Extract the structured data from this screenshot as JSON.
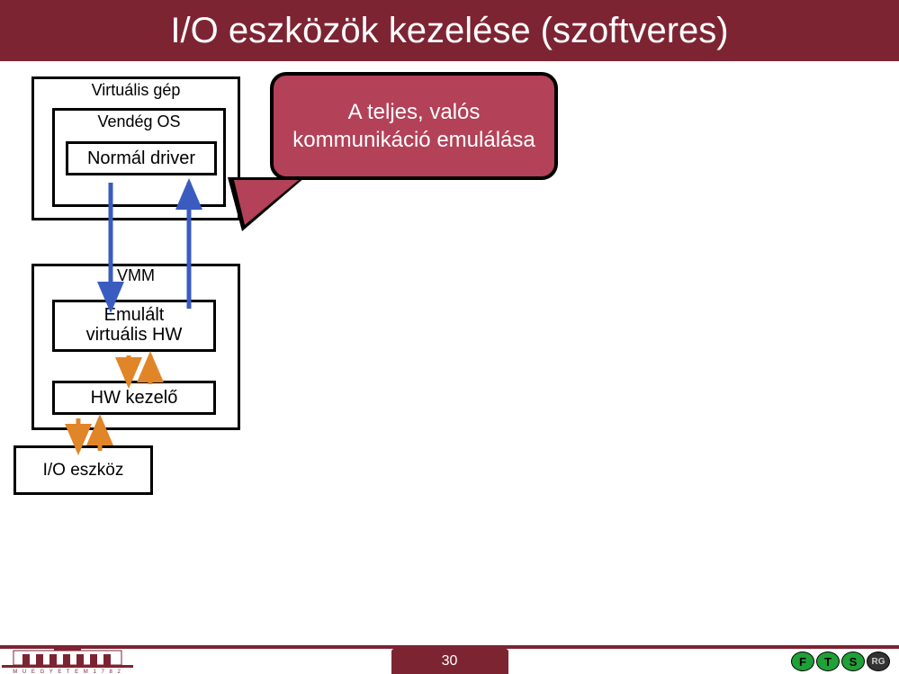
{
  "title": "I/O eszközök kezelése (szoftveres)",
  "diagram": {
    "vm_label": "Virtuális gép",
    "guest_os_label": "Vendég OS",
    "driver_label": "Normál driver",
    "vmm_label": "VMM",
    "emul_hw_line1": "Emulált",
    "emul_hw_line2": "virtuális HW",
    "hw_kezelo_label": "HW kezelő",
    "io_device_label": "I/O eszköz"
  },
  "callout_text": "A teljes, valós kommunikáció emulálása",
  "page_number": "30",
  "logo_right_letters": [
    "F",
    "T",
    "S",
    "RG"
  ],
  "colors": {
    "header": "#7d2433",
    "callout": "#b34158",
    "arrow_blue": "#3a5cc0",
    "arrow_orange": "#e08528",
    "icon_green": "#1fa038"
  }
}
